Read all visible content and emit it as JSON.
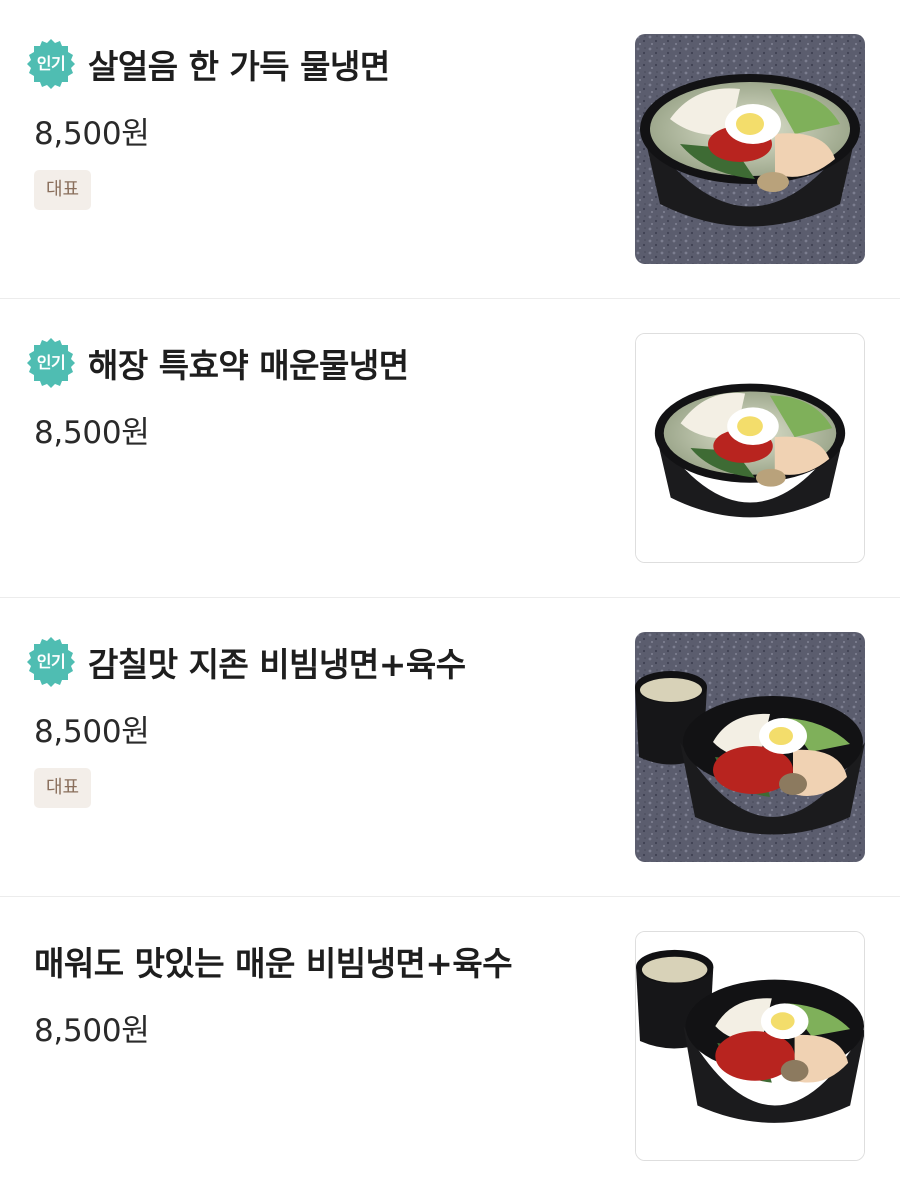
{
  "badge_label": "인기",
  "items": [
    {
      "name": "살얼음 한 가득 물냉면",
      "price": "8,500원",
      "tag": "대표",
      "popular": true
    },
    {
      "name": "해장 특효약 매운물냉면",
      "price": "8,500원",
      "popular": true
    },
    {
      "name": "감칠맛 지존 비빔냉면+육수",
      "price": "8,500원",
      "tag": "대표",
      "popular": true
    },
    {
      "name": "매워도 맛있는 매운 비빔냉면+육수",
      "price": "8,500원",
      "popular": false
    }
  ],
  "colors": {
    "badge": "#4fbdb2",
    "tag_bg": "#f3eee9",
    "tag_text": "#8a6f5c",
    "divider": "#ececec"
  }
}
